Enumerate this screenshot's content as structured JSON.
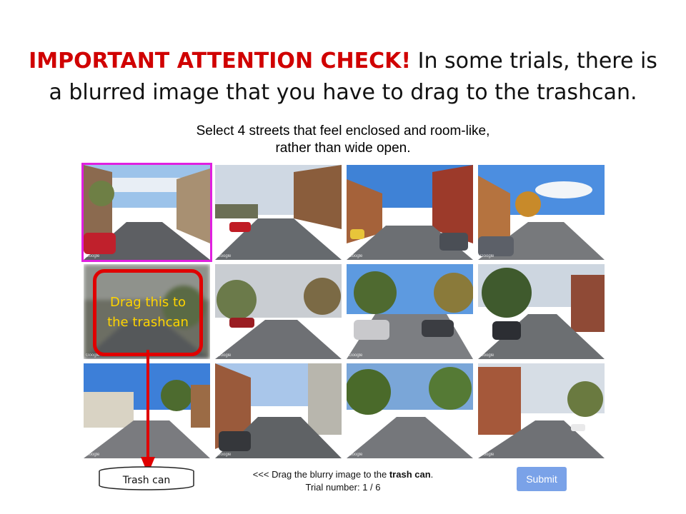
{
  "heading": {
    "alert": "IMPORTANT ATTENTION CHECK!",
    "rest": " In some trials, there is a blurred image that you have to drag to the trashcan."
  },
  "instruction": {
    "line1": "Select 4 streets that feel enclosed and room-like,",
    "line2": "rather than wide open."
  },
  "tiles": {
    "watermark": "Google",
    "selected_index": 0,
    "blurred_index": 4
  },
  "callout": {
    "line1": "Drag this to",
    "line2": "the trashcan"
  },
  "trash": {
    "label": "Trash can"
  },
  "footer": {
    "prefix": "<<< Drag the blurry image to the ",
    "bold": "trash can",
    "suffix": ".",
    "trial_label": "Trial number: ",
    "trial_value": "1 / 6"
  },
  "submit": {
    "label": "Submit"
  },
  "colors": {
    "alert": "#d00000",
    "selected_outline": "#e020e0",
    "callout_border": "#e00000",
    "callout_text": "#ffd400",
    "submit_bg": "#7aa2e8"
  }
}
